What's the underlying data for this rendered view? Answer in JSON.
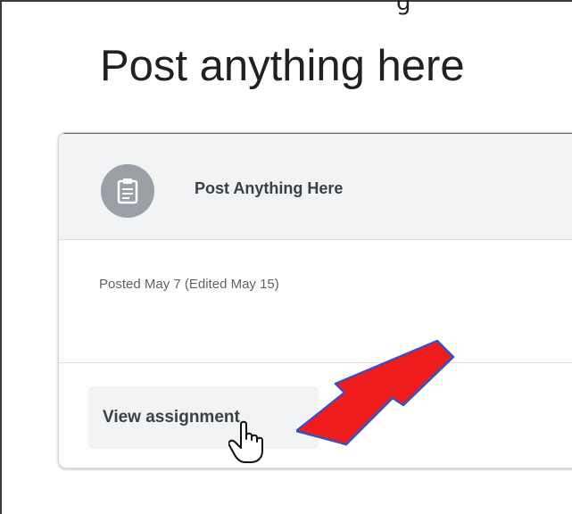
{
  "header": {
    "partial_text": "g",
    "title": "Post anything here"
  },
  "card": {
    "icon": "assignment-icon",
    "title": "Post Anything Here",
    "posted_meta": "Posted May 7 (Edited May 15)",
    "action_label": "View assignment"
  },
  "annotation": {
    "arrow_color": "#ee1c1c",
    "arrow_outline": "#3a50c0",
    "cursor": "hand-pointer-icon"
  },
  "colors": {
    "header_bg": "#f1f3f4",
    "avatar_bg": "#9aa0a6",
    "title_text": "#202124"
  }
}
